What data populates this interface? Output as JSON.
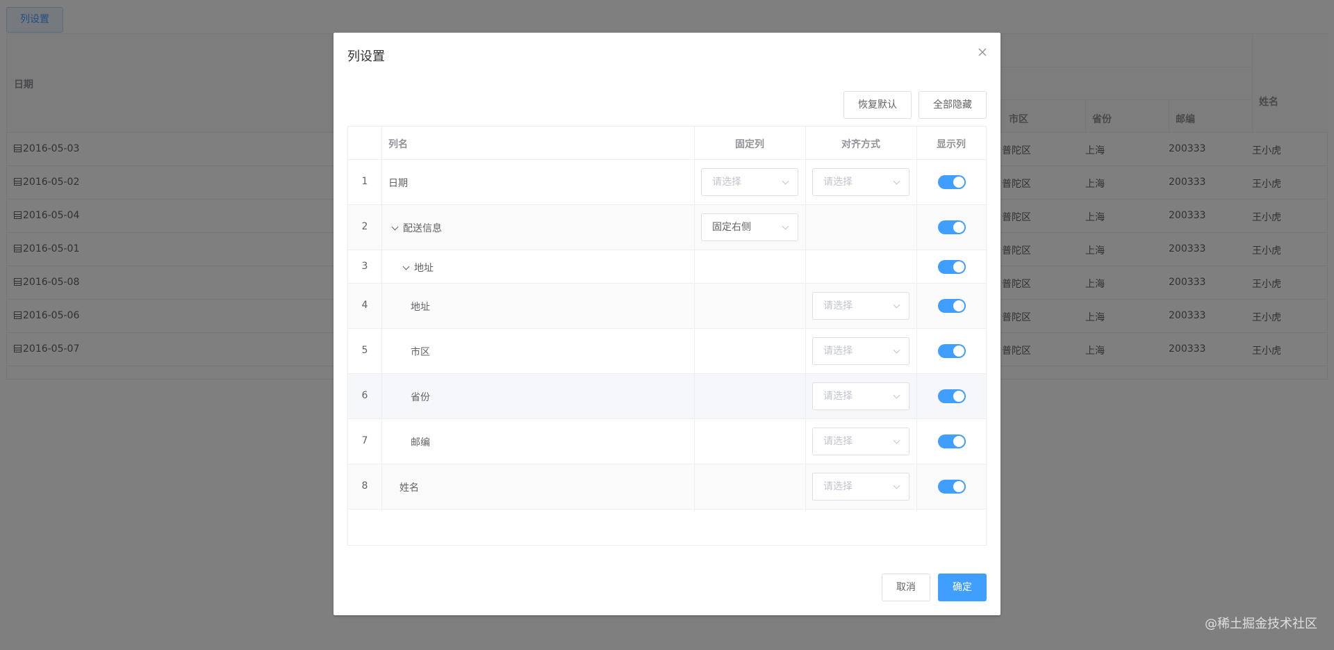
{
  "background": {
    "column_settings_button": "列设置",
    "headers": {
      "date": "日期",
      "city": "市区",
      "province": "省份",
      "zip": "邮编",
      "name": "姓名"
    },
    "rows": [
      {
        "date": "2016-05-03",
        "city": "普陀区",
        "province": "上海",
        "zip": "200333",
        "name": "王小虎"
      },
      {
        "date": "2016-05-02",
        "city": "普陀区",
        "province": "上海",
        "zip": "200333",
        "name": "王小虎"
      },
      {
        "date": "2016-05-04",
        "city": "普陀区",
        "province": "上海",
        "zip": "200333",
        "name": "王小虎"
      },
      {
        "date": "2016-05-01",
        "city": "普陀区",
        "province": "上海",
        "zip": "200333",
        "name": "王小虎"
      },
      {
        "date": "2016-05-08",
        "city": "普陀区",
        "province": "上海",
        "zip": "200333",
        "name": "王小虎"
      },
      {
        "date": "2016-05-06",
        "city": "普陀区",
        "province": "上海",
        "zip": "200333",
        "name": "王小虎"
      },
      {
        "date": "2016-05-07",
        "city": "普陀区",
        "province": "上海",
        "zip": "200333",
        "name": "王小虎"
      }
    ],
    "watermark": "@稀土掘金技术社区"
  },
  "dialog": {
    "title": "列设置",
    "reset_button": "恢复默认",
    "hide_all_button": "全部隐藏",
    "columns": {
      "name": "列名",
      "fixed": "固定列",
      "align": "对齐方式",
      "visible": "显示列"
    },
    "rows": [
      {
        "index": "1",
        "name": "日期",
        "fixed": "请选择",
        "align": "请选择",
        "visible": true
      },
      {
        "index": "2",
        "name": "配送信息",
        "fixed": "固定右侧",
        "align": "",
        "visible": true
      },
      {
        "index": "3",
        "name": "地址",
        "fixed": "",
        "align": "",
        "visible": true
      },
      {
        "index": "4",
        "name": "地址",
        "fixed": "",
        "align": "请选择",
        "visible": true
      },
      {
        "index": "5",
        "name": "市区",
        "fixed": "",
        "align": "请选择",
        "visible": true
      },
      {
        "index": "6",
        "name": "省份",
        "fixed": "",
        "align": "请选择",
        "visible": true
      },
      {
        "index": "7",
        "name": "邮编",
        "fixed": "",
        "align": "请选择",
        "visible": true
      },
      {
        "index": "8",
        "name": "姓名",
        "fixed": "",
        "align": "请选择",
        "visible": true
      }
    ],
    "cancel_button": "取消",
    "confirm_button": "确定"
  },
  "colors": {
    "primary": "#409eff",
    "border": "#ebeef5",
    "overlay": "rgba(0,0,0,0.5)"
  }
}
